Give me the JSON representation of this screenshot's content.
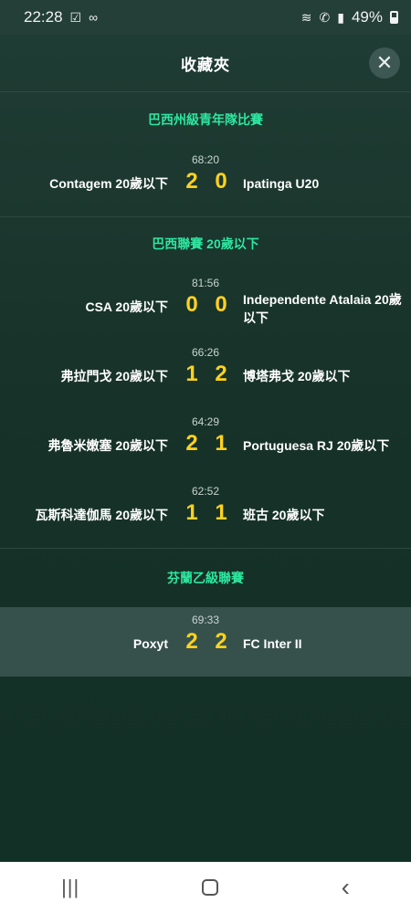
{
  "status_bar": {
    "time": "22:28",
    "battery": "49%",
    "icons": [
      "checkbox-icon",
      "sks-icon",
      "wifi-icon",
      "call-icon",
      "signal-icon",
      "battery-icon"
    ]
  },
  "header": {
    "title": "收藏夾",
    "close_icon": "close-icon"
  },
  "leagues": [
    {
      "name": "巴西州級青年隊比賽",
      "matches": [
        {
          "time": "68:20",
          "home": "Contagem 20歲以下",
          "home_score": "2",
          "away_score": "0",
          "away": "Ipatinga U20"
        }
      ]
    },
    {
      "name": "巴西聯賽 20歲以下",
      "matches": [
        {
          "time": "81:56",
          "home": "CSA 20歲以下",
          "home_score": "0",
          "away_score": "0",
          "away": "Independente Atalaia 20歲以下"
        },
        {
          "time": "66:26",
          "home": "弗拉門戈 20歲以下",
          "home_score": "1",
          "away_score": "2",
          "away": "博塔弗戈 20歲以下"
        },
        {
          "time": "64:29",
          "home": "弗魯米嫩塞 20歲以下",
          "home_score": "2",
          "away_score": "1",
          "away": "Portuguesa RJ 20歲以下"
        },
        {
          "time": "62:52",
          "home": "瓦斯科達伽馬 20歲以下",
          "home_score": "1",
          "away_score": "1",
          "away": "班古 20歲以下"
        }
      ]
    },
    {
      "name": "芬蘭乙級聯賽",
      "matches": [
        {
          "time": "69:33",
          "home": "Poxyt",
          "home_score": "2",
          "away_score": "2",
          "away": "FC Inter II"
        }
      ]
    }
  ],
  "colors": {
    "accent_green": "#2ee6a0",
    "score_yellow": "#ffd21f",
    "background": "#173228"
  },
  "nav_bar": {
    "icons": [
      "recents-icon",
      "home-icon",
      "back-icon"
    ]
  }
}
